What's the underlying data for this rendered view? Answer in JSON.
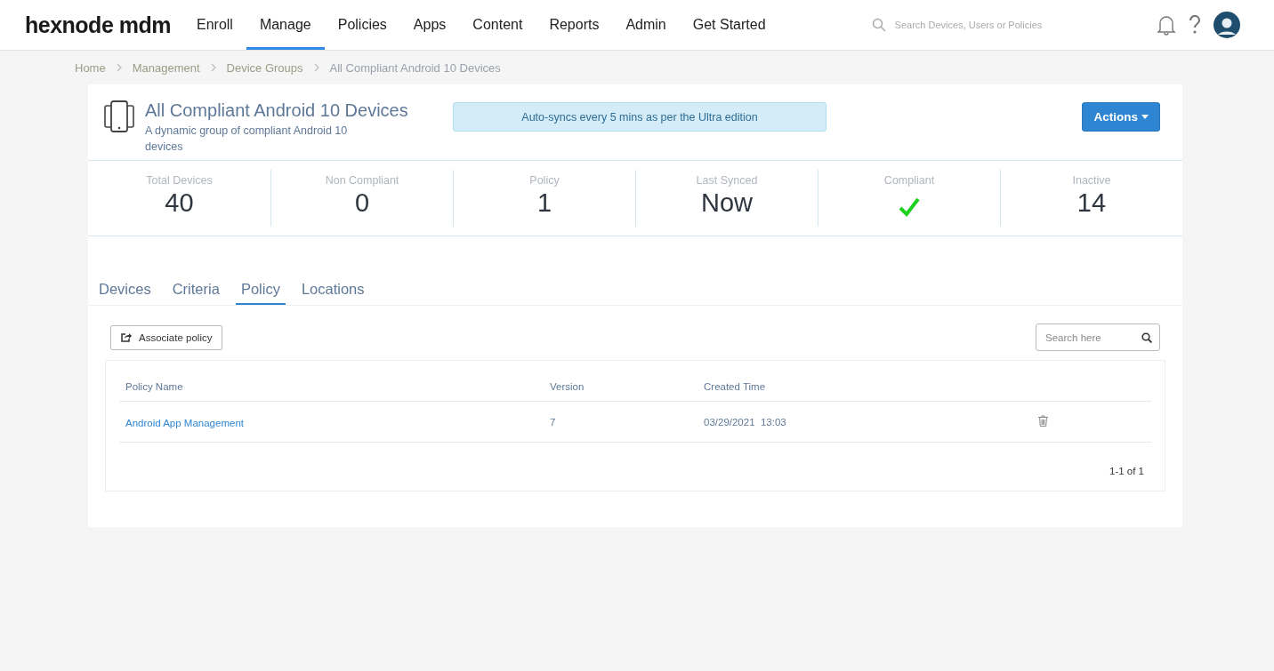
{
  "topbar": {
    "logo": "hexnode mdm",
    "nav": [
      {
        "label": "Enroll",
        "selected": false
      },
      {
        "label": "Manage",
        "selected": true
      },
      {
        "label": "Policies",
        "selected": false
      },
      {
        "label": "Apps",
        "selected": false
      },
      {
        "label": "Content",
        "selected": false
      },
      {
        "label": "Reports",
        "selected": false
      },
      {
        "label": "Admin",
        "selected": false
      },
      {
        "label": "Get Started",
        "selected": false
      }
    ],
    "search": {
      "placeholder": "Search Devices, Users or Policies"
    }
  },
  "breadcrumbs": [
    {
      "label": "Home",
      "current": false
    },
    {
      "label": "Management",
      "current": false
    },
    {
      "label": "Device Groups",
      "current": false
    },
    {
      "label": "All Compliant Android 10 Devices",
      "current": true
    }
  ],
  "group": {
    "title": "All Compliant Android 10 Devices",
    "description": "A dynamic group of compliant Android 10 devices",
    "notice": "Auto-syncs every 5 mins as per the Ultra edition",
    "actions_button": "Actions"
  },
  "stats": [
    {
      "label": "Total Devices",
      "kind": "number",
      "value": "40"
    },
    {
      "label": "Non Compliant",
      "kind": "number",
      "value": "0"
    },
    {
      "label": "Policy",
      "kind": "number",
      "value": "1"
    },
    {
      "label": "Last Synced",
      "kind": "number",
      "value": "Now"
    },
    {
      "label": "Compliant",
      "kind": "check"
    },
    {
      "label": "Inactive",
      "kind": "number",
      "value": "14"
    }
  ],
  "tabs": [
    {
      "label": "Devices",
      "selected": false
    },
    {
      "label": "Criteria",
      "selected": false
    },
    {
      "label": "Policy",
      "selected": true
    },
    {
      "label": "Locations",
      "selected": false
    }
  ],
  "toolbar": {
    "associate_button": "Associate policy",
    "search": {
      "placeholder": "Search here"
    }
  },
  "table": {
    "columns": [
      "Policy Name",
      "Version",
      "Created Time"
    ],
    "rows": [
      {
        "policy_name": "Android App Management",
        "version": "7",
        "created_time": "03/29/2021  13:03"
      }
    ],
    "pagination": "1-1 of 1"
  }
}
